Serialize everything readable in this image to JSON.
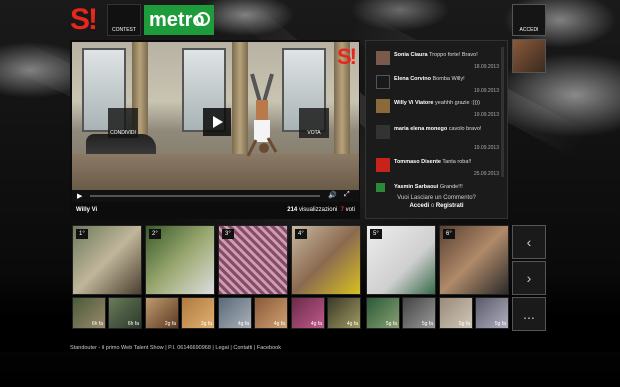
{
  "header": {
    "logo_text": "S!",
    "contest_label": "CONTEST",
    "metro_label": "metro",
    "login_label": "ACCEDI"
  },
  "player": {
    "badge": "S!",
    "share_label": "CONDIVIDI",
    "vote_label": "VOTA",
    "user_name": "Willy Vi",
    "views_count": "214",
    "views_label": "visualizzazioni",
    "votes_count": "7",
    "votes_label": "voti",
    "progress": 0.0
  },
  "comments": {
    "items": [
      {
        "author": "Sonia Ciaura",
        "text": "Troppo forte! Bravo!",
        "date": "18.09.2013"
      },
      {
        "author": "Elena Corvino",
        "text": "Bomba Willy!",
        "date": "19.09.2013"
      },
      {
        "author": "Willy Vi Viatore",
        "text": "yeahhh grazie :))))",
        "date": "19.09.2013"
      },
      {
        "author": "maria elena monego",
        "text": "cavolo bravo!",
        "date": "19.09.2013"
      },
      {
        "author": "Tommaso Disente",
        "text": "Tanta roba!!",
        "date": "25.09.2013"
      },
      {
        "author": "Yasmin Sarbaoui",
        "text": "Grande!!!",
        "date": ""
      }
    ],
    "cta_question": "Vuoi Lasciare un Commento?",
    "cta_login": "Accedi",
    "cta_or": "o",
    "cta_register": "Registrati"
  },
  "ranking": {
    "items": [
      {
        "rank": "1°"
      },
      {
        "rank": "2°"
      },
      {
        "rank": "3°"
      },
      {
        "rank": "4°"
      },
      {
        "rank": "5°"
      },
      {
        "rank": "6°"
      }
    ]
  },
  "recent": {
    "items": [
      {
        "ago": "6h fa"
      },
      {
        "ago": "6h fa"
      },
      {
        "ago": "2g fa"
      },
      {
        "ago": "3g fa"
      },
      {
        "ago": "4g fa"
      },
      {
        "ago": "4g fa"
      },
      {
        "ago": "4g fa"
      },
      {
        "ago": "4g fa"
      },
      {
        "ago": "5g fa"
      },
      {
        "ago": "5g fa"
      },
      {
        "ago": "5g fa"
      },
      {
        "ago": "5g fa"
      }
    ]
  },
  "nav": {
    "prev_icon": "chevron-left-icon",
    "next_icon": "chevron-right-icon",
    "more_label": "..."
  },
  "footer": {
    "brand": "Standouter - il primo Web Talent Show",
    "piva": "P.I. 06146690968",
    "legal": "Legal",
    "contacts": "Contatti",
    "facebook": "Facebook",
    "sep": "|"
  },
  "colors": {
    "brand_red": "#e8271c",
    "metro_green": "#1e9b3a",
    "votes_red": "#e8271c"
  }
}
